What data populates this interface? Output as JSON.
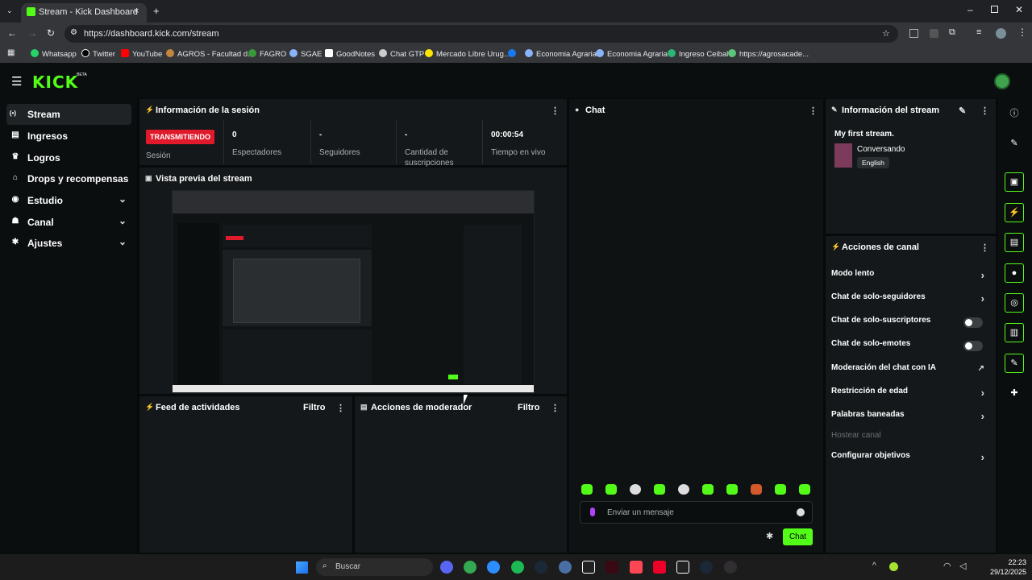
{
  "browser": {
    "tab_title": "Stream - Kick Dashboard",
    "url": "https://dashboard.kick.com/stream",
    "bookmarks": [
      "Whatsapp",
      "Twitter",
      "YouTube",
      "AGROS - Facultad d...",
      "FAGRO",
      "SGAE",
      "GoodNotes",
      "Chat GTP",
      "Mercado Libre Urug...",
      "",
      "Economia Agraria",
      "Economia Agraria",
      "Ingreso Ceibal",
      "https://agrosacade..."
    ]
  },
  "app": {
    "logo": "KICK",
    "beta": "BETA",
    "sidebar": [
      {
        "label": "Stream",
        "icon": "broadcast-icon",
        "glyph": "(•)"
      },
      {
        "label": "Ingresos",
        "icon": "income-icon",
        "glyph": "▤"
      },
      {
        "label": "Logros",
        "icon": "trophy-icon",
        "glyph": "♛"
      },
      {
        "label": "Drops y recompensas",
        "icon": "gift-icon",
        "glyph": "⌂"
      },
      {
        "label": "Estudio",
        "icon": "studio-icon",
        "glyph": "◉"
      },
      {
        "label": "Canal",
        "icon": "channel-icon",
        "glyph": "☗"
      },
      {
        "label": "Ajustes",
        "icon": "settings-icon",
        "glyph": "✱"
      }
    ]
  },
  "session": {
    "title": "Información de la sesión",
    "live_badge": "TRANSMITIENDO",
    "session_label": "Sesión",
    "stats": [
      {
        "value": "0",
        "label": "Espectadores"
      },
      {
        "value": "-",
        "label": "Seguidores"
      },
      {
        "value": "-",
        "label": "Cantidad de suscripciones"
      },
      {
        "value": "00:00:54",
        "label": "Tiempo en vivo"
      }
    ]
  },
  "preview": {
    "title": "Vista previa del stream"
  },
  "feed": {
    "title": "Feed de actividades",
    "filter": "Filtro"
  },
  "modactions": {
    "title": "Acciones de moderador",
    "filter": "Filtro"
  },
  "chat": {
    "title": "Chat",
    "input_placeholder": "Enviar un mensaje",
    "send_label": "Chat",
    "emote_count": 10
  },
  "stream_info": {
    "title": "Información del stream",
    "stream_title": "My first stream.",
    "category": "Conversando",
    "language": "English"
  },
  "channel_actions": {
    "title": "Acciones de canal",
    "items": [
      {
        "label": "Modo lento",
        "control": "chevron"
      },
      {
        "label": "Chat de solo-seguidores",
        "control": "chevron"
      },
      {
        "label": "Chat de solo-suscriptores",
        "control": "toggle",
        "enabled": false
      },
      {
        "label": "Chat de solo-emotes",
        "control": "toggle",
        "enabled": false
      },
      {
        "label": "Moderación del chat con IA",
        "control": "external"
      },
      {
        "label": "Restricción de edad",
        "control": "chevron"
      },
      {
        "label": "Palabras baneadas",
        "control": "chevron"
      },
      {
        "label": "Hostear canal",
        "control": "disabled"
      },
      {
        "label": "Configurar objetivos",
        "control": "chevron"
      }
    ]
  },
  "taskbar": {
    "search_placeholder": "Buscar",
    "time": "22:23",
    "date": "29/12/2025"
  },
  "colors": {
    "accent": "#53fc18",
    "live": "#e01a2b",
    "panel": "#14181a",
    "background": "#070a0b"
  }
}
